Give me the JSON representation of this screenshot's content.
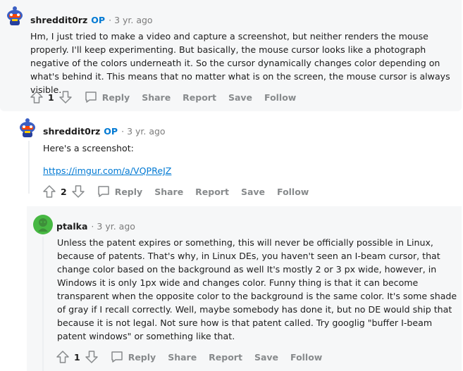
{
  "comments": [
    {
      "username": "shreddit0rz",
      "op": "OP",
      "time": "3 yr. ago",
      "body": [
        "Hm, I just tried to make a video and capture a screenshot, but neither renders the mouse properly. I'll keep experimenting. But basically, the mouse cursor looks like a photograph negative of the colors underneath it. So the cursor dynamically changes color depending on what's behind it. This means that no matter what is on the screen, the mouse cursor is always visible."
      ],
      "score": "1",
      "actions": {
        "reply": "Reply",
        "share": "Share",
        "report": "Report",
        "save": "Save",
        "follow": "Follow"
      }
    },
    {
      "username": "shreddit0rz",
      "op": "OP",
      "time": "3 yr. ago",
      "body": [
        "Here's a screenshot:"
      ],
      "link": "https://imgur.com/a/VQPReJZ",
      "score": "2",
      "actions": {
        "reply": "Reply",
        "share": "Share",
        "report": "Report",
        "save": "Save",
        "follow": "Follow"
      }
    },
    {
      "username": "ptalka",
      "time": "3 yr. ago",
      "body": [
        "Unless the patent expires or something, this will never be officially possible in Linux, because of patents. That's why, in Linux DEs, you haven't seen an I-beam cursor, that change color based on the background as well It's mostly 2 or 3 px wide, however, in Windows it is only 1px wide and changes color. Funny thing is that it can become transparent when the opposite color to the background is the same color. It's some shade of gray if I recall correctly. Well, maybe somebody has done it, but no DE would ship that because it is not legal. Not sure how is that patent called. Try googlig \"buffer I-beam patent windows\" or something like that."
      ],
      "score": "1",
      "actions": {
        "reply": "Reply",
        "share": "Share",
        "report": "Report",
        "save": "Save",
        "follow": "Follow"
      }
    }
  ],
  "colors": {
    "op": "#0079d3",
    "link": "#0079d3",
    "meta": "#7c7c7c",
    "action": "#878a8c"
  },
  "icons": [
    "upvote-icon",
    "downvote-icon",
    "comment-icon",
    "snoo-avatar-icon"
  ]
}
